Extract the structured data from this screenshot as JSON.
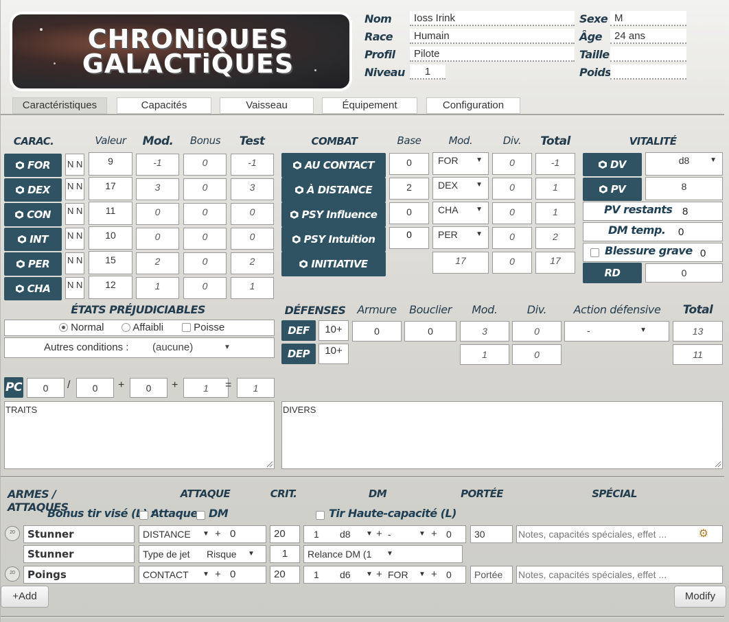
{
  "logo": {
    "line1": "CHRONiQUES",
    "line2": "GALACTiQUES"
  },
  "info": {
    "nom_label": "Nom",
    "nom": "Ioss Irink",
    "race_label": "Race",
    "race": "Humain",
    "profil_label": "Profil",
    "profil": "Pilote",
    "niveau_label": "Niveau",
    "niveau": "1",
    "sexe_label": "Sexe",
    "sexe": "M",
    "age_label": "Âge",
    "age": "24 ans",
    "taille_label": "Taille",
    "taille": "",
    "poids_label": "Poids",
    "poids": ""
  },
  "tabs": [
    {
      "label": "Caractéristiques",
      "active": true
    },
    {
      "label": "Capacités"
    },
    {
      "label": "Vaisseau"
    },
    {
      "label": "Équipement"
    },
    {
      "label": "Configuration"
    }
  ],
  "carac": {
    "headers": {
      "carac": "CARAC.",
      "valeur": "Valeur",
      "mod": "Mod.",
      "bonus": "Bonus",
      "test": "Test"
    },
    "rows": [
      {
        "name": "FOR",
        "nm": "N N",
        "valeur": "9",
        "mod": "-1",
        "bonus": "0",
        "test": "-1"
      },
      {
        "name": "DEX",
        "nm": "N N",
        "valeur": "17",
        "mod": "3",
        "bonus": "0",
        "test": "3"
      },
      {
        "name": "CON",
        "nm": "N N",
        "valeur": "11",
        "mod": "0",
        "bonus": "0",
        "test": "0"
      },
      {
        "name": "INT",
        "nm": "N N",
        "valeur": "10",
        "mod": "0",
        "bonus": "0",
        "test": "0"
      },
      {
        "name": "PER",
        "nm": "N N",
        "valeur": "15",
        "mod": "2",
        "bonus": "0",
        "test": "2"
      },
      {
        "name": "CHA",
        "nm": "N N",
        "valeur": "12",
        "mod": "1",
        "bonus": "0",
        "test": "1"
      }
    ]
  },
  "combat": {
    "headers": {
      "combat": "COMBAT",
      "base": "Base",
      "mod": "Mod.",
      "div": "Div.",
      "total": "Total"
    },
    "rows": [
      {
        "name": "AU CONTACT",
        "base": "0",
        "mod": "FOR",
        "div": "0",
        "total": "-1"
      },
      {
        "name": "À DISTANCE",
        "base": "2",
        "mod": "DEX",
        "div": "0",
        "total": "1"
      },
      {
        "name": "PSY Influence",
        "base": "0",
        "mod": "CHA",
        "div": "0",
        "total": "1"
      },
      {
        "name": "PSY Intuition",
        "base": "0",
        "mod": "PER",
        "div": "0",
        "total": "2"
      }
    ],
    "initiative": {
      "name": "INITIATIVE",
      "mod": "17",
      "div": "0",
      "total": "17"
    }
  },
  "vitalite": {
    "header": "VITALITÉ",
    "dv_label": "DV",
    "dv": "d8",
    "pv_label": "PV",
    "pv": "8",
    "pv_restants_label": "PV restants",
    "pv_restants": "8",
    "dm_temp_label": "DM temp.",
    "dm_temp": "0",
    "blessure_label": "Blessure grave",
    "blessure": "0",
    "rd_label": "RD",
    "rd": "0"
  },
  "etats": {
    "header": "ÉTATS PRÉJUDICIABLES",
    "normal": "Normal",
    "affaibli": "Affaibli",
    "poisse": "Poisse",
    "autres_label": "Autres conditions :",
    "autres_value": "(aucune)"
  },
  "defenses": {
    "headers": {
      "defenses": "DÉFENSES",
      "armure": "Armure",
      "bouclier": "Bouclier",
      "mod": "Mod.",
      "div": "Div.",
      "action": "Action défensive",
      "total": "Total"
    },
    "def": {
      "label": "DEF",
      "base": "10+",
      "armure": "0",
      "bouclier": "0",
      "mod": "3",
      "div": "0",
      "action": "-",
      "total": "13"
    },
    "dep": {
      "label": "DEP",
      "base": "10+",
      "mod": "1",
      "div": "0",
      "total": "11"
    }
  },
  "pc": {
    "label": "PC",
    "v1": "0",
    "sep1": "/",
    "v2": "0",
    "plus1": "+",
    "v3": "0",
    "plus2": "+",
    "v4": "1",
    "eq": "=",
    "total": "1"
  },
  "traits": "TRAITS",
  "divers": "DIVERS",
  "armes": {
    "headers": {
      "armes": "ARMES / ATTAQUES",
      "attaque": "ATTAQUE",
      "crit": "CRIT.",
      "dm": "DM",
      "portee": "PORTÉE",
      "special": "SPÉCIAL"
    },
    "bonus_label": "Bonus tir visé (L) :",
    "attaque_chk": "Attaque",
    "dm_chk": "DM",
    "tir_hc": "Tir Haute-capacité (L)",
    "rows": [
      {
        "name": "Stunner",
        "type": "DISTANCE",
        "plus": "+",
        "att": "0",
        "crit": "20",
        "nb": "1",
        "de": "d8",
        "plus2": "+",
        "mod": "-",
        "plus3": "+",
        "dm": "0",
        "portee": "30",
        "notes": "Notes, capacités spéciales, effet ..."
      },
      {
        "name": "Poings",
        "type": "CONTACT",
        "plus": "+",
        "att": "0",
        "crit": "20",
        "nb": "1",
        "de": "d6",
        "plus2": "+",
        "mod": "FOR",
        "plus3": "+",
        "dm": "0",
        "portee": "Portée",
        "notes": "Notes, capacités spéciales, effet ..."
      }
    ],
    "sub": {
      "name": "Stunner",
      "type_label": "Type de jet",
      "type": "Risque",
      "value": "1",
      "relance": "Relance DM (1"
    }
  },
  "buttons": {
    "add": "+Add",
    "modify": "Modify"
  }
}
